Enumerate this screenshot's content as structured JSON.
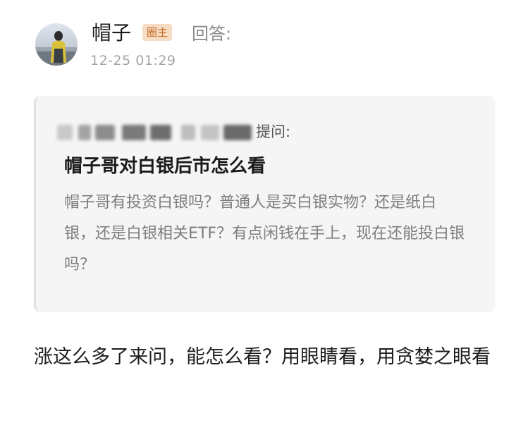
{
  "post": {
    "author": {
      "name": "帽子",
      "badge": "圈主",
      "action_label": "回答:",
      "avatar_icon": "person-photo-avatar"
    },
    "timestamp": "12-25 01:29",
    "question": {
      "asked_label": "提问:",
      "title": "帽子哥对白银后市怎么看",
      "body": "帽子哥有投资白银吗？普通人是买白银实物？还是纸白银，还是白银相关ETF？有点闲钱在手上，现在还能投白银吗？"
    },
    "answer": "涨这么多了来问，能怎么看？用眼睛看，用贪婪之眼看"
  },
  "colors": {
    "badge_bg": "#f6dcc3",
    "badge_text": "#c36a23",
    "card_bg": "#f5f5f5",
    "muted_text": "#a5a5a5"
  }
}
